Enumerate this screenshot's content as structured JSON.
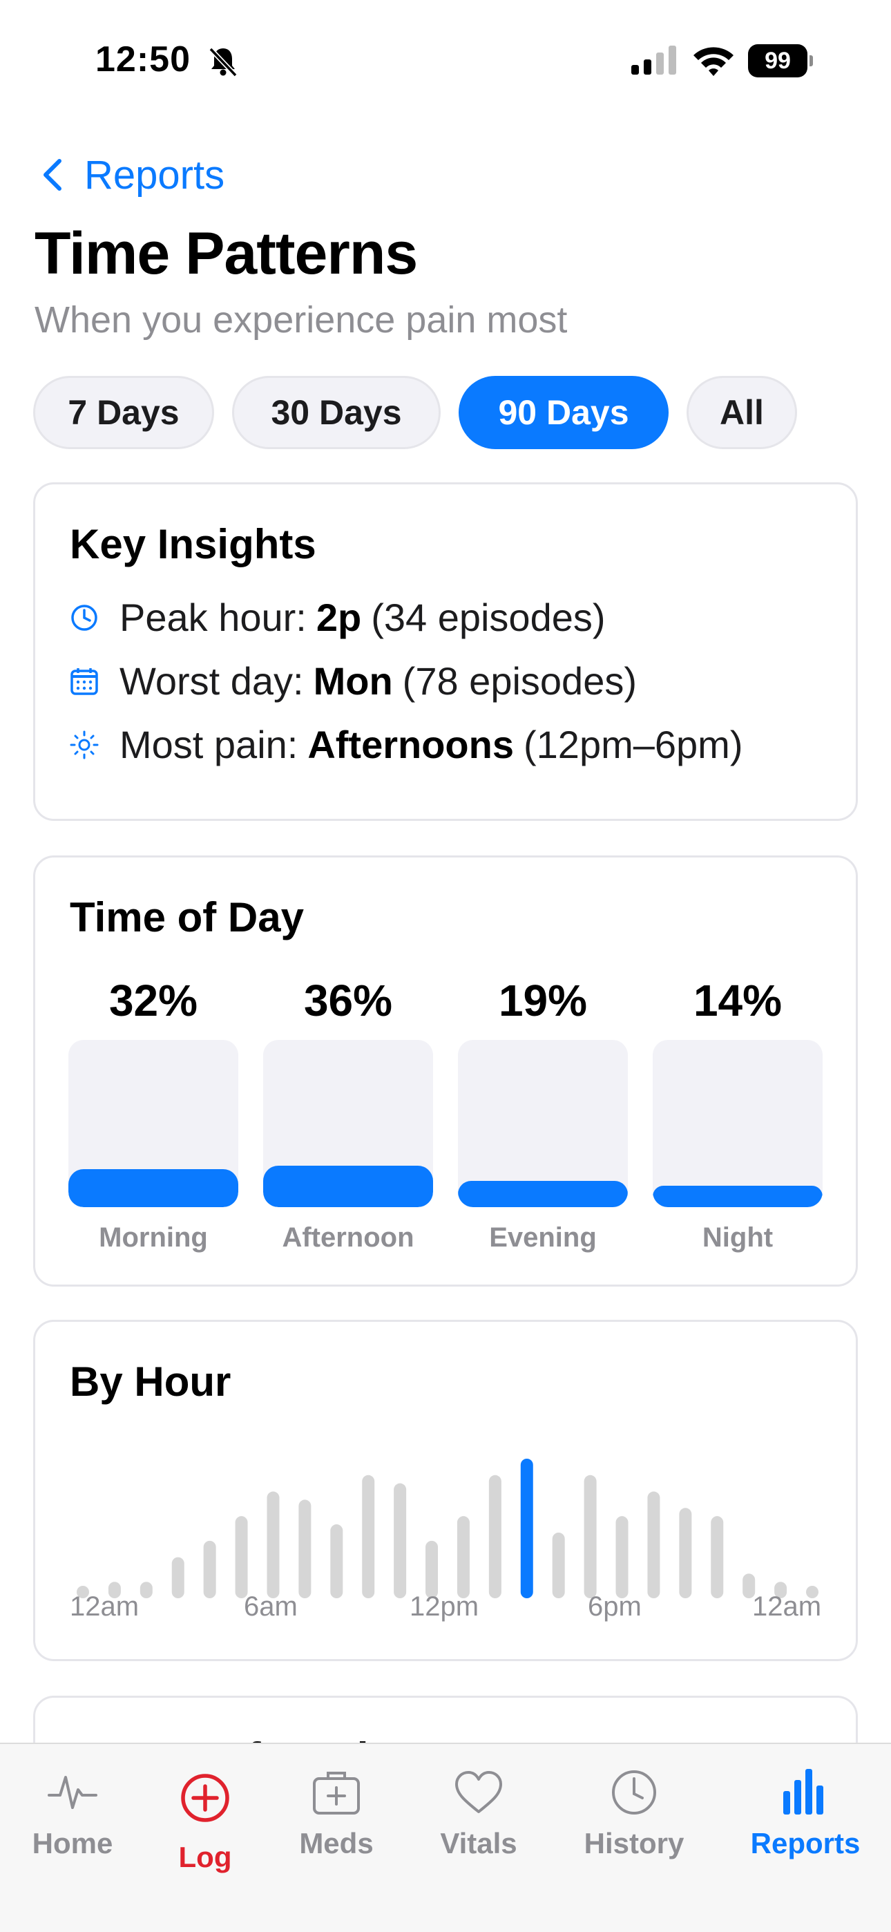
{
  "status_bar": {
    "time": "12:50",
    "battery": "99"
  },
  "nav": {
    "back_label": "Reports"
  },
  "header": {
    "title": "Time Patterns",
    "subtitle": "When you experience pain most"
  },
  "range_pills": [
    {
      "label": "7 Days",
      "active": false
    },
    {
      "label": "30 Days",
      "active": false
    },
    {
      "label": "90 Days",
      "active": true
    },
    {
      "label": "All",
      "active": false
    }
  ],
  "insights": {
    "title": "Key Insights",
    "rows": [
      {
        "icon": "clock-icon",
        "prefix": "Peak hour:",
        "value": "2p",
        "detail": "(34 episodes)"
      },
      {
        "icon": "calendar-icon",
        "prefix": "Worst day:",
        "value": "Mon",
        "detail": "(78 episodes)"
      },
      {
        "icon": "sun-icon",
        "prefix": "Most pain:",
        "value": "Afternoons",
        "detail": "(12pm–6pm)"
      }
    ]
  },
  "time_of_day": {
    "title": "Time of Day",
    "items": [
      {
        "label": "Morning",
        "percent_text": "32%",
        "fill": 0.32
      },
      {
        "label": "Afternoon",
        "percent_text": "36%",
        "fill": 0.36
      },
      {
        "label": "Evening",
        "percent_text": "19%",
        "fill": 0.19
      },
      {
        "label": "Night",
        "percent_text": "14%",
        "fill": 0.14
      }
    ]
  },
  "by_hour": {
    "title": "By Hour",
    "axis_labels": [
      "12am",
      "6am",
      "12pm",
      "6pm",
      "12am"
    ],
    "highlight_index": 14
  },
  "next_card": {
    "title": "By Day of Week"
  },
  "tab_bar": {
    "tabs": [
      {
        "label": "Home",
        "icon": "heartbeat-icon",
        "active": false
      },
      {
        "label": "Log",
        "icon": "plus-circle-icon",
        "active": false
      },
      {
        "label": "Meds",
        "icon": "medkit-icon",
        "active": false
      },
      {
        "label": "Vitals",
        "icon": "heart-icon",
        "active": false
      },
      {
        "label": "History",
        "icon": "clock-icon",
        "active": false
      },
      {
        "label": "Reports",
        "icon": "bar-chart-icon",
        "active": true
      }
    ]
  },
  "colors": {
    "accent": "#0a7aff",
    "log_red": "#e0222d",
    "muted": "#8e8e93",
    "track": "#f2f2f7",
    "hour_bar": "#d6d6d6"
  },
  "chart_data": {
    "type": "bar",
    "title": "By Hour",
    "categories": [
      "12am",
      "1am",
      "2am",
      "3am",
      "4am",
      "5am",
      "6am",
      "7am",
      "8am",
      "9am",
      "10am",
      "11am",
      "12pm",
      "1pm",
      "2pm",
      "3pm",
      "4pm",
      "5pm",
      "6pm",
      "7pm",
      "8pm",
      "9pm",
      "10pm",
      "11pm"
    ],
    "values": [
      1,
      2,
      2,
      5,
      7,
      10,
      13,
      12,
      9,
      15,
      14,
      7,
      10,
      15,
      17,
      8,
      15,
      10,
      13,
      11,
      10,
      3,
      2,
      0
    ],
    "x_tick_labels": [
      "12am",
      "6am",
      "12pm",
      "6pm",
      "12am"
    ],
    "ylim": [
      0,
      17
    ],
    "grid": false
  }
}
